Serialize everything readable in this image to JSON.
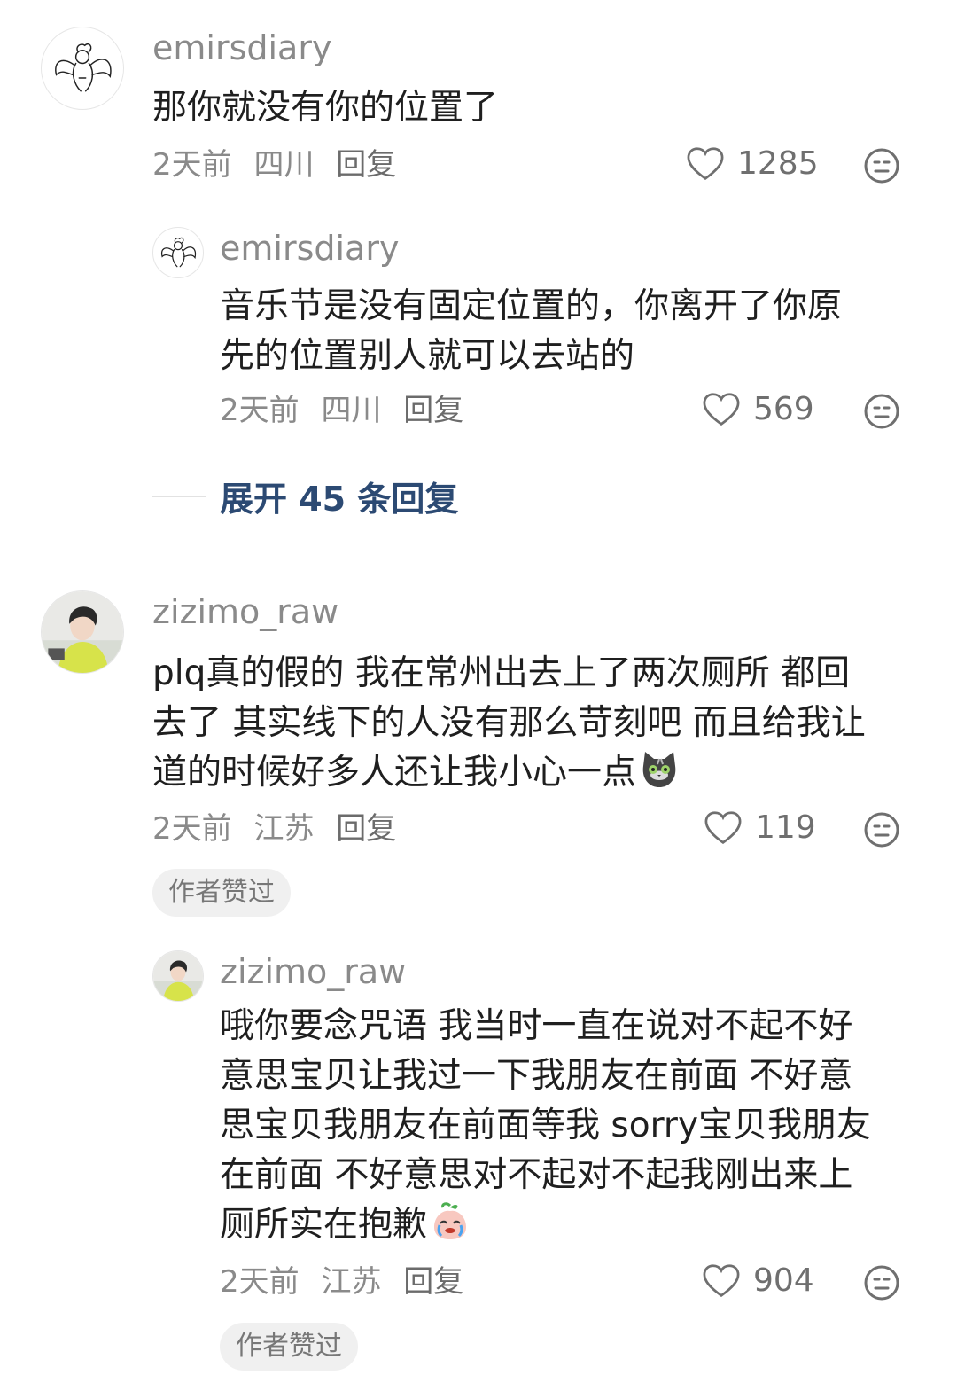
{
  "comments": [
    {
      "username": "emirsdiary",
      "text": "那你就没有你的位置了",
      "time": "2天前",
      "location": "四川",
      "reply_label": "回复",
      "likes": "1285",
      "avatar": "angel-sketch-avatar",
      "replies": [
        {
          "username": "emirsdiary",
          "text": "音乐节是没有固定位置的，你离开了你原\n先的位置别人就可以去站的",
          "time": "2天前",
          "location": "四川",
          "reply_label": "回复",
          "likes": "569",
          "avatar": "angel-sketch-avatar"
        }
      ],
      "expand_label": "展开 45 条回复"
    },
    {
      "username": "zizimo_raw",
      "text": "plq真的假的 我在常州出去上了两次厕所 都回\n去了 其实线下的人没有那么苛刻吧 而且给我让\n道的时候好多人还让我小心一点",
      "text_emoji": "cat-face-emoji",
      "time": "2天前",
      "location": "江苏",
      "reply_label": "回复",
      "likes": "119",
      "badge": "作者赞过",
      "avatar": "person-photo-avatar",
      "replies": [
        {
          "username": "zizimo_raw",
          "text": "哦你要念咒语 我当时一直在说对不起不好\n意思宝贝让我过一下我朋友在前面 不好意\n思宝贝我朋友在前面等我 sorry宝贝我朋友\n在前面 不好意思对不起对不起我刚出来上\n厕所实在抱歉",
          "text_emoji": "crying-peach-emoji",
          "time": "2天前",
          "location": "江苏",
          "reply_label": "回复",
          "likes": "904",
          "badge": "作者赞过",
          "avatar": "person-photo-avatar"
        }
      ]
    }
  ],
  "icons": {
    "like": "heart-outline-icon",
    "reaction": "neutral-face-icon"
  },
  "colors": {
    "username": "#8a8a8a",
    "expand_link": "#2c4a73",
    "badge_bg": "#f0f0f0"
  }
}
